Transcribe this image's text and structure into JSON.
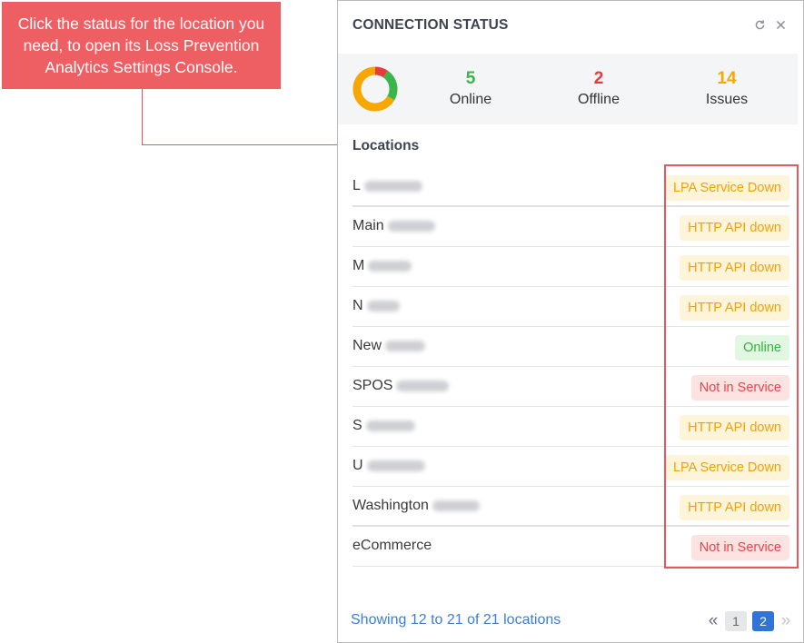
{
  "callout": {
    "text": "Click the status for the location you need, to open its Loss Prevention Analytics Settings Console."
  },
  "panel": {
    "title": "CONNECTION STATUS",
    "icons": [
      "refresh-icon",
      "close-icon"
    ]
  },
  "summary": {
    "online": {
      "value": "5",
      "label": "Online"
    },
    "offline": {
      "value": "2",
      "label": "Offline"
    },
    "issues": {
      "value": "14",
      "label": "Issues"
    },
    "donut_colors": {
      "online": "#3bb54a",
      "offline": "#e83b3b",
      "issues": "#f6a800"
    }
  },
  "locations": {
    "title": "Locations",
    "rows": [
      {
        "name": "L",
        "status": "LPA Service Down",
        "kind": "warn"
      },
      {
        "name": "Main",
        "status": "HTTP API down",
        "kind": "warn"
      },
      {
        "name": "M",
        "status": "HTTP API down",
        "kind": "warn"
      },
      {
        "name": "N",
        "status": "HTTP API down",
        "kind": "warn"
      },
      {
        "name": "New",
        "status": "Online",
        "kind": "ok"
      },
      {
        "name": "SPOS",
        "status": "Not in Service",
        "kind": "err"
      },
      {
        "name": "S",
        "status": "HTTP API down",
        "kind": "warn"
      },
      {
        "name": "U",
        "status": "LPA Service Down",
        "kind": "warn"
      },
      {
        "name": "Washington",
        "status": "HTTP API down",
        "kind": "warn"
      },
      {
        "name": "eCommerce",
        "status": "Not in Service",
        "kind": "err"
      }
    ]
  },
  "footer": {
    "showing": "Showing 12 to 21 of 21 locations",
    "pages": [
      "1",
      "2"
    ],
    "first_glyph": "«",
    "last_glyph": "»"
  }
}
